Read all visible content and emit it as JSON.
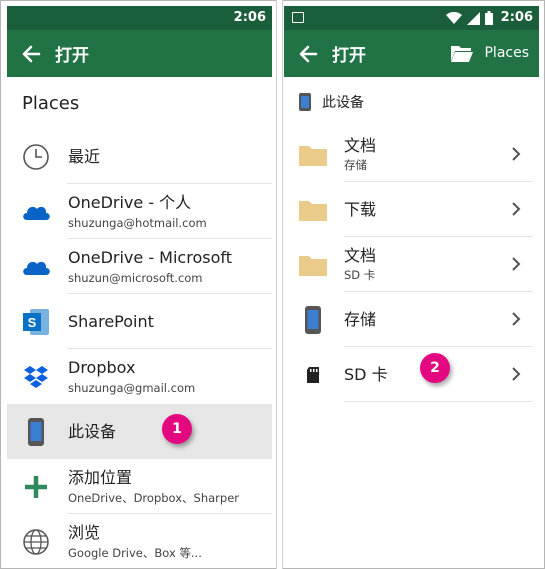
{
  "colors": {
    "appbar": "#217346",
    "statusbar": "#1b5e3c",
    "badge": "#e3087f",
    "folder": "#eacb8a",
    "onedrive": "#0a64c8",
    "sharepoint": "#0a72c4",
    "dropbox": "#0b61e0",
    "add": "#2e8a5c"
  },
  "left": {
    "status_time": "2:06",
    "appbar_title": "打开",
    "section_title": "Places",
    "items": [
      {
        "icon": "clock-icon",
        "label": "最近",
        "sub": ""
      },
      {
        "icon": "onedrive-icon",
        "label": "OneDrive - 个人",
        "sub": "shuzunga@hotmail.com"
      },
      {
        "icon": "onedrive-icon",
        "label": "OneDrive - Microsoft",
        "sub": "shuzun@microsoft.com"
      },
      {
        "icon": "sharepoint-icon",
        "label": "SharePoint",
        "sub": ""
      },
      {
        "icon": "dropbox-icon",
        "label": "Dropbox",
        "sub": "shuzunga@gmail.com"
      },
      {
        "icon": "phone-icon",
        "label": "此设备",
        "sub": ""
      },
      {
        "icon": "add-icon",
        "label": "添加位置",
        "sub": "OneDrive、Dropbox、Sharper"
      },
      {
        "icon": "globe-icon",
        "label": "浏览",
        "sub": "Google Drive、Box 等..."
      }
    ],
    "step_badge": "1"
  },
  "right": {
    "status_time": "2:06",
    "appbar_title": "打开",
    "places_label": "Places",
    "device_heading": "此设备",
    "items": [
      {
        "icon": "folder-icon",
        "label": "文档",
        "sub": "存储"
      },
      {
        "icon": "folder-icon",
        "label": "下载",
        "sub": ""
      },
      {
        "icon": "folder-icon",
        "label": "文档",
        "sub": "SD 卡"
      },
      {
        "icon": "phone-icon",
        "label": "存储",
        "sub": ""
      },
      {
        "icon": "sd-card-icon",
        "label": "SD 卡",
        "sub": ""
      }
    ],
    "step_badge": "2"
  }
}
